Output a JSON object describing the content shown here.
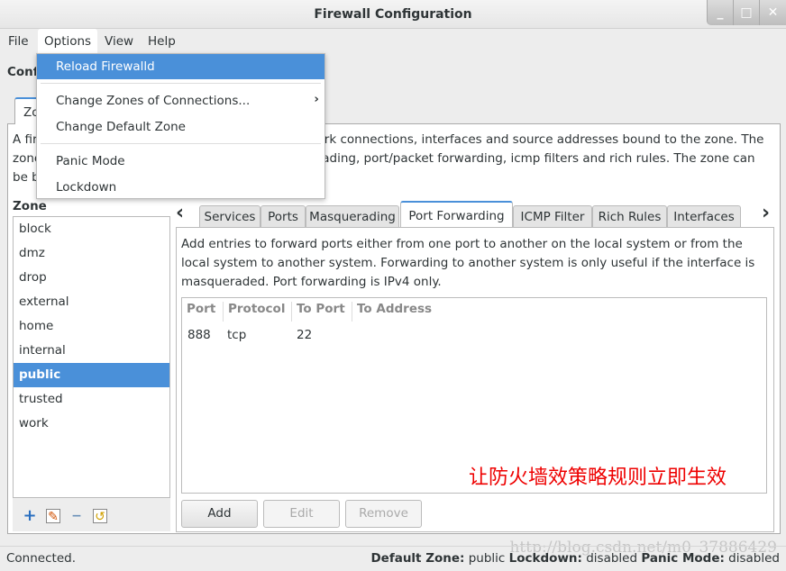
{
  "window": {
    "title": "Firewall Configuration",
    "minimize": "_",
    "maximize": "□",
    "close": "✕"
  },
  "menubar": [
    "File",
    "Options",
    "View",
    "Help"
  ],
  "options_menu": {
    "items": [
      "Reload Firewalld",
      "Change Zones of Connections...",
      "Change Default Zone",
      "Panic Mode",
      "Lockdown"
    ],
    "submenu_arrow": "›"
  },
  "configuration_label": "Configuration:",
  "top_tab": "Zones",
  "zone_description": "A firewalld zone defines the level of trust for network connections, interfaces and source addresses bound to the zone. The zone combines services, ports, protocols, masquerading, port/packet forwarding, icmp filters and rich rules. The zone can be bound to interfaces and source addresses.",
  "zone_header": "Zone",
  "zones": [
    "block",
    "dmz",
    "drop",
    "external",
    "home",
    "internal",
    "public",
    "trusted",
    "work"
  ],
  "selected_zone": "public",
  "zone_tools": [
    "add-icon",
    "edit-icon",
    "remove-icon",
    "load-defaults-icon"
  ],
  "tabs": [
    "Services",
    "Ports",
    "Masquerading",
    "Port Forwarding",
    "ICMP Filter",
    "Rich Rules",
    "Interfaces"
  ],
  "active_tab": "Port Forwarding",
  "port_forwarding": {
    "description": "Add entries to forward ports either from one port to another on the local system or from the local system to another system. Forwarding to another system is only useful if the interface is masqueraded. Port forwarding is IPv4 only.",
    "columns": [
      "Port",
      "Protocol",
      "To Port",
      "To Address"
    ],
    "rows": [
      [
        "888",
        "tcp",
        "22",
        ""
      ]
    ],
    "buttons": {
      "add": "Add",
      "edit": "Edit",
      "remove": "Remove"
    }
  },
  "annotation": "让防火墙效策略规则立即生效",
  "status": {
    "connection": "Connected.",
    "default_zone_label": "Default Zone:",
    "default_zone": "public",
    "lockdown_label": "Lockdown:",
    "lockdown": "disabled",
    "panic_label": "Panic Mode:",
    "panic": "disabled"
  },
  "watermark": "http://blog.csdn.net/m0_37886429",
  "colors": {
    "accent": "#4a90d9",
    "annotation": "#ee0000"
  }
}
